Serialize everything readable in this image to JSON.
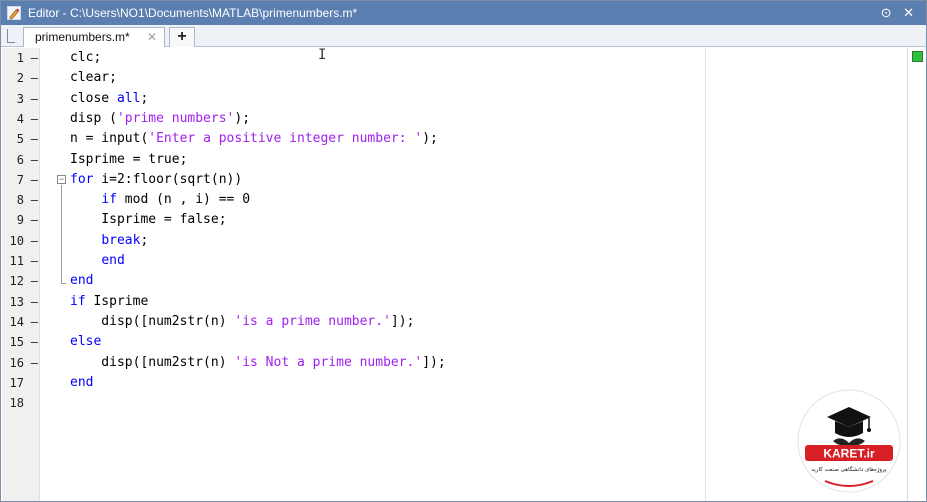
{
  "window": {
    "title": "Editor - C:\\Users\\NO1\\Documents\\MATLAB\\primenumbers.m*",
    "controls": "⊙ ✕"
  },
  "tabs": [
    {
      "label": "primenumbers.m*",
      "close": "✕"
    }
  ],
  "add_tab_label": "+",
  "line_numbers": [
    "1",
    "2",
    "3",
    "4",
    "5",
    "6",
    "7",
    "8",
    "9",
    "10",
    "11",
    "12",
    "13",
    "14",
    "15",
    "16",
    "17",
    "18"
  ],
  "line_dashes": [
    "–",
    "–",
    "–",
    "–",
    "–",
    "–",
    "–",
    "–",
    "–",
    "–",
    "–",
    "–",
    "–",
    "–",
    "–",
    "–",
    "",
    ""
  ],
  "code_lines": [
    "clc;",
    "clear;",
    "close all;",
    "disp ('prime numbers');",
    "n = input('Enter a positive integer number: ');",
    "Isprime = true;",
    "for i=2:floor(sqrt(n))",
    "    if mod (n , i) == 0",
    "    Isprime = false;",
    "    break;",
    "    end",
    "end",
    "if Isprime",
    "    disp([num2str(n) 'is a prime number.']);",
    "else",
    "    disp([num2str(n) 'is Not a prime number.']);",
    "end",
    ""
  ],
  "code_tokens": {
    "l3_kw": "all",
    "l4_str": "'prime numbers'",
    "l5_str": "'Enter a positive integer number: '",
    "l7_kw": "for",
    "l8_kw": "if",
    "l10_kw": "break",
    "l11_kw": "end",
    "l12_kw": "end",
    "l13_kw": "if",
    "l14_str": "'is a prime number.'",
    "l15_kw": "else",
    "l16_str": "'is Not a prime number.'",
    "l17_kw": "end"
  },
  "logo": {
    "brand": "KARET.ir",
    "tagline": "پروژه‌های دانشگاهی صنعت کارید"
  },
  "colors": {
    "titlebar": "#5b7fb0",
    "keyword": "#0000ff",
    "string": "#a020f0",
    "status_ok": "#2fbf3f"
  }
}
